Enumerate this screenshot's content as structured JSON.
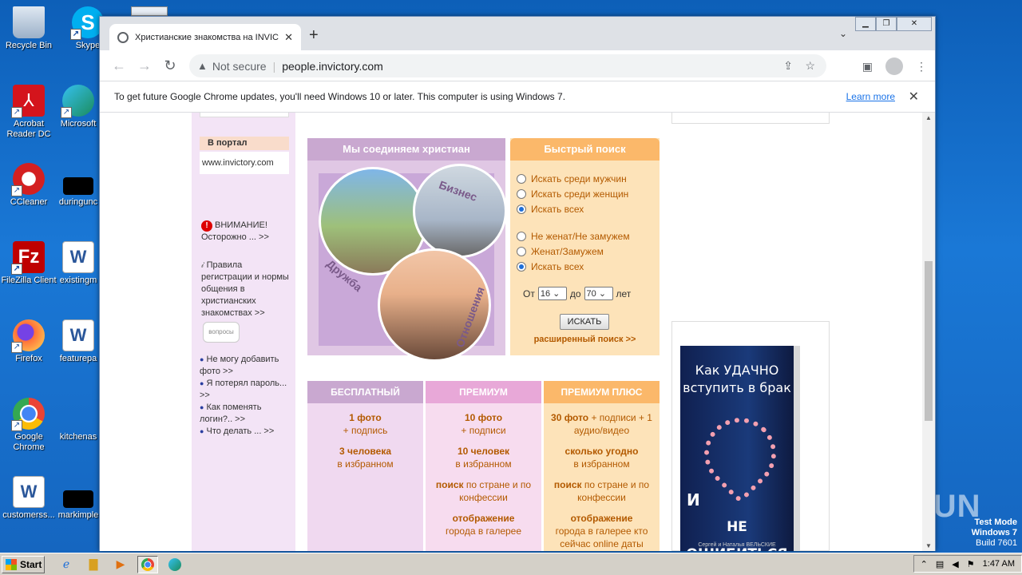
{
  "desktop": {
    "icons": [
      {
        "label": "Recycle Bin"
      },
      {
        "label": "Skype"
      },
      {
        "label": "Acrobat Reader DC"
      },
      {
        "label": "Microsoft"
      },
      {
        "label": "CCleaner"
      },
      {
        "label": "duringunc"
      },
      {
        "label": "FileZilla Client"
      },
      {
        "label": "existingm"
      },
      {
        "label": "Firefox"
      },
      {
        "label": "featurepa"
      },
      {
        "label": "Google Chrome"
      },
      {
        "label": "kitchenas"
      },
      {
        "label": "customerss..."
      },
      {
        "label": "markimple"
      }
    ],
    "watermark": "ANY RUN",
    "test_mode": {
      "line1": "Test Mode",
      "line2": "Windows 7",
      "line3": "Build 7601"
    }
  },
  "browser": {
    "tab_title": "Христианские знакомства на INVIC",
    "url_warning": "Not secure",
    "url": "people.invictory.com",
    "infobar_text": "To get future Google Chrome updates, you'll need Windows 10 or later. This computer is using Windows 7.",
    "infobar_link": "Learn more"
  },
  "page": {
    "sidebar": {
      "portal_header": "В портал",
      "portal_link": "www.invictory.com",
      "warning_line1": "ВНИМАНИЕ!",
      "warning_line2": "Осторожно ... >>",
      "rules": "Правила регистрации и нормы общения в христианских знакомствах >>",
      "questions_label": "вопросы",
      "faq": [
        "Не могу добавить фото >>",
        "Я потерял пароль... >>",
        "Как поменять логин?.. >>",
        "Что делать ... >>"
      ]
    },
    "hero": {
      "title": "Мы соединяем христиан",
      "label_business": "Бизнес",
      "label_friendship": "Дружба",
      "label_relations": "Отношения"
    },
    "quick_search": {
      "title": "Быстрый поиск",
      "gender_options": [
        {
          "label": "Искать среди мужчин",
          "checked": false
        },
        {
          "label": "Искать среди женщин",
          "checked": false
        },
        {
          "label": "Искать всех",
          "checked": true
        }
      ],
      "status_options": [
        {
          "label": "Не женат/Не замужем",
          "checked": false
        },
        {
          "label": "Женат/Замужем",
          "checked": false
        },
        {
          "label": "Искать всех",
          "checked": true
        }
      ],
      "age_from_label": "От",
      "age_from": "16",
      "age_to_label": "до",
      "age_to": "70",
      "age_unit": "лет",
      "search_button": "ИСКАТЬ",
      "advanced_link": "расширенный поиск >>"
    },
    "plans": [
      {
        "name": "БЕСПЛАТНЫЙ",
        "header_color": "#c9a8d0",
        "body_color": "#f0d9f0",
        "lines": [
          {
            "bold": "1 фото",
            "normal": "+ подпись"
          },
          {
            "bold": "3 человека",
            "normal": "в избранном"
          }
        ]
      },
      {
        "name": "ПРЕМИУМ",
        "header_color": "#e8a8d8",
        "body_color": "#f7dcef",
        "lines": [
          {
            "bold": "10 фото",
            "normal": "+ подписи"
          },
          {
            "bold": "10 человек",
            "normal": "в избранном"
          },
          {
            "bold": "поиск",
            "normal": "по стране и по конфессии"
          },
          {
            "bold": "отображение",
            "normal": "города в галерее"
          }
        ]
      },
      {
        "name": "ПРЕМИУМ ПЛЮС",
        "header_color": "#fbb86a",
        "body_color": "#fde3b9",
        "lines": [
          {
            "bold": "30 фото",
            "normal": "+ подписи + 1 аудио/видео"
          },
          {
            "bold": "сколько угодно",
            "normal": "в избранном"
          },
          {
            "bold": "поиск",
            "normal": "по стране и по конфессии"
          },
          {
            "bold": "отображение",
            "normal": "города в галерее кто сейчас online даты посл.захода"
          }
        ]
      }
    ],
    "ad_book": {
      "title": "Как УДАЧНО вступить в брак",
      "subtitle1": "И",
      "subtitle2": "НЕ ОШИБИТЬСЯ",
      "authors": "Сергей и Наталья ВЕЛЬСКИЕ"
    }
  },
  "taskbar": {
    "start_label": "Start",
    "clock": "1:47 AM"
  }
}
